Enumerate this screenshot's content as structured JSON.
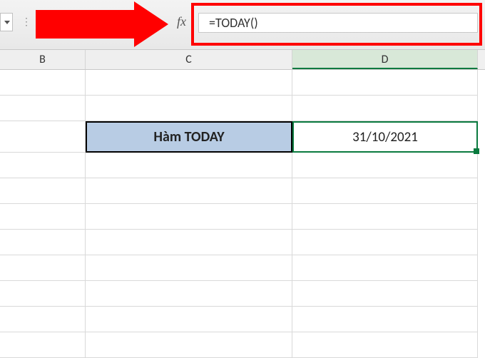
{
  "formula_bar": {
    "fx_label": "fx",
    "value": "=TODAY()"
  },
  "columns": {
    "B": "B",
    "C": "C",
    "D": "D"
  },
  "cells": {
    "C_label": "Hàm TODAY",
    "D_result": "31/10/2021"
  },
  "dots": "⋮"
}
